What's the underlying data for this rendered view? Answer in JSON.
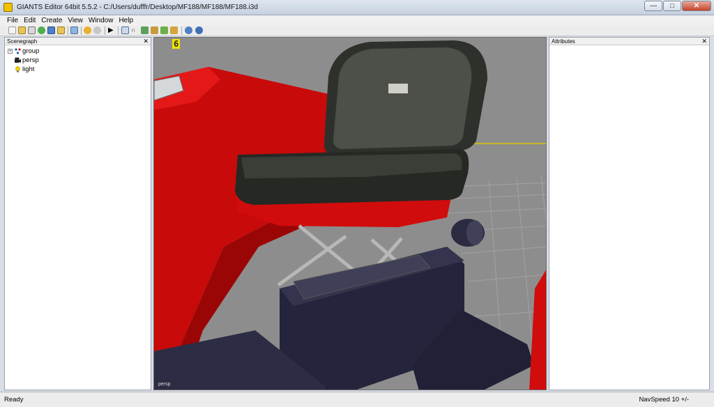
{
  "window": {
    "title": "GIANTS Editor 64bit 5.5.2 - C:/Users/dufffr/Desktop/MF188/MF188/MF188.i3d"
  },
  "menu": {
    "items": [
      "File",
      "Edit",
      "Create",
      "View",
      "Window",
      "Help"
    ]
  },
  "toolbar": {
    "icons": [
      "new-file-icon",
      "open-file-icon",
      "save-icon",
      "refresh-icon",
      "save-as-icon",
      "export-icon",
      "import-icon",
      "undo-icon",
      "redo-icon",
      "play-icon",
      "select-tool-icon",
      "move-tool-icon",
      "paint-terrain-icon",
      "sculpt-icon",
      "foliage-icon",
      "paint-icon",
      "settings-icon",
      "settings-alt-icon"
    ]
  },
  "scenegraph": {
    "title": "Scenegraph",
    "nodes": [
      {
        "label": "group",
        "icon": "group-node-icon",
        "expandable": true
      },
      {
        "label": "persp",
        "icon": "camera-node-icon",
        "expandable": false
      },
      {
        "label": "light",
        "icon": "light-node-icon",
        "expandable": false
      }
    ]
  },
  "attributes": {
    "title": "Attributes"
  },
  "viewport": {
    "counter": "6",
    "camera_label": "persp"
  },
  "status": {
    "left": "Ready",
    "right": "NavSpeed 10 +/-"
  },
  "colors": {
    "viewport_bg": "#8d8d8d",
    "tractor_red": "#d40d0d",
    "seat_dark": "#2a2c2a",
    "base_navy": "#23233b",
    "highlight_yellow": "#f1e400"
  }
}
